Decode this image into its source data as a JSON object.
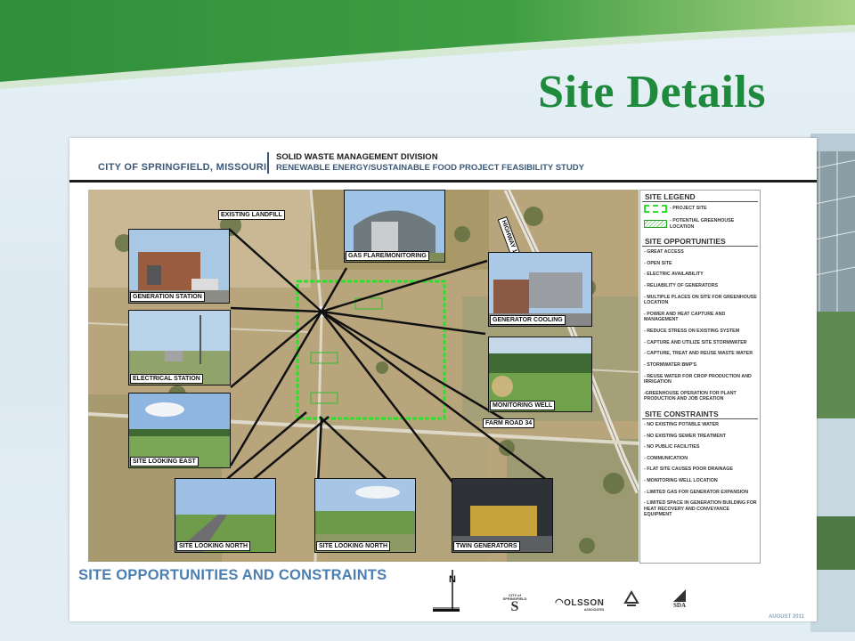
{
  "slide_title": "Site Details",
  "poster": {
    "city": "CITY OF SPRINGFIELD, MISSOURI",
    "division": "SOLID WASTE MANAGEMENT DIVISION",
    "study": "RENEWABLE ENERGY/SUSTAINABLE FOOD PROJECT FEASIBILITY STUDY",
    "footer_title": "SITE OPPORTUNITIES AND CONSTRAINTS",
    "north_letter": "N",
    "date": "AUGUST 2011"
  },
  "map": {
    "labels": {
      "existing_landfill": "EXISTING LANDFILL",
      "highway": "HIGHWAY 13",
      "farm_road": "FARM ROAD 34"
    },
    "photos": {
      "gas_flare": "GAS FLARE/MONITORING",
      "generation_station": "GENERATION STATION",
      "generator_cooling": "GENERATOR COOLING",
      "electrical_station": "ELECTRICAL STATION",
      "monitoring_well": "MONITORING WELL",
      "site_looking_east": "SITE LOOKING EAST",
      "site_looking_north_1": "SITE LOOKING NORTH",
      "site_looking_north_2": "SITE LOOKING NORTH",
      "twin_generators": "TWIN GENERATORS"
    }
  },
  "legend": {
    "site_legend": "SITE LEGEND",
    "project_site": "- PROJECT SITE",
    "greenhouse": "- POTENTIAL GREENHOUSE LOCATION",
    "opportunities_title": "SITE OPPORTUNITIES",
    "opportunities": [
      "- GREAT ACCESS",
      "- OPEN SITE",
      "- ELECTRIC AVAILABILITY",
      "- RELIABILITY OF GENERATORS",
      "- MULTIPLE PLACES ON SITE FOR GREENHOUSE LOCATION",
      "- POWER AND HEAT CAPTURE AND MANAGEMENT",
      "- REDUCE STRESS ON EXISTING SYSTEM",
      "- CAPTURE AND UTILIZE SITE STORMWATER",
      "- CAPTURE, TREAT AND REUSE WASTE WATER",
      "- STORMWATER BMP'S",
      "- REUSE WATER FOR CROP PRODUCTION AND IRRIGATION",
      "-GREENHOUSE OPERATION FOR PLANT PRODUCTION AND JOB CREATION"
    ],
    "constraints_title": "SITE CONSTRAINTS",
    "constraints": [
      "- NO EXISTING POTABLE WATER",
      "- NO EXISTING SEWER TREATMENT",
      "- NO PUBLIC FACILITIES",
      "- COMMUNICATION",
      "- FLAT SITE CAUSES POOR DRAINAGE",
      "- MONITORING WELL LOCATION",
      "- LIMITED GAS FOR GENERATOR EXPANSION",
      "- LIMITED SPACE IN GENERATION BUILDING FOR HEAT RECOVERY AND CONVEYANCE EQUIPMENT"
    ]
  },
  "logos": {
    "springfield": "CITY of SPRINGFIELD",
    "olsson": "OLSSON",
    "olsson_sub": "ASSOCIATES",
    "sda": "SDA"
  },
  "colors": {
    "title_green": "#1e8a3b",
    "header_blue": "#3a5878",
    "footer_blue": "#4b7fb2",
    "project_site_outline": "#2ce02c"
  }
}
